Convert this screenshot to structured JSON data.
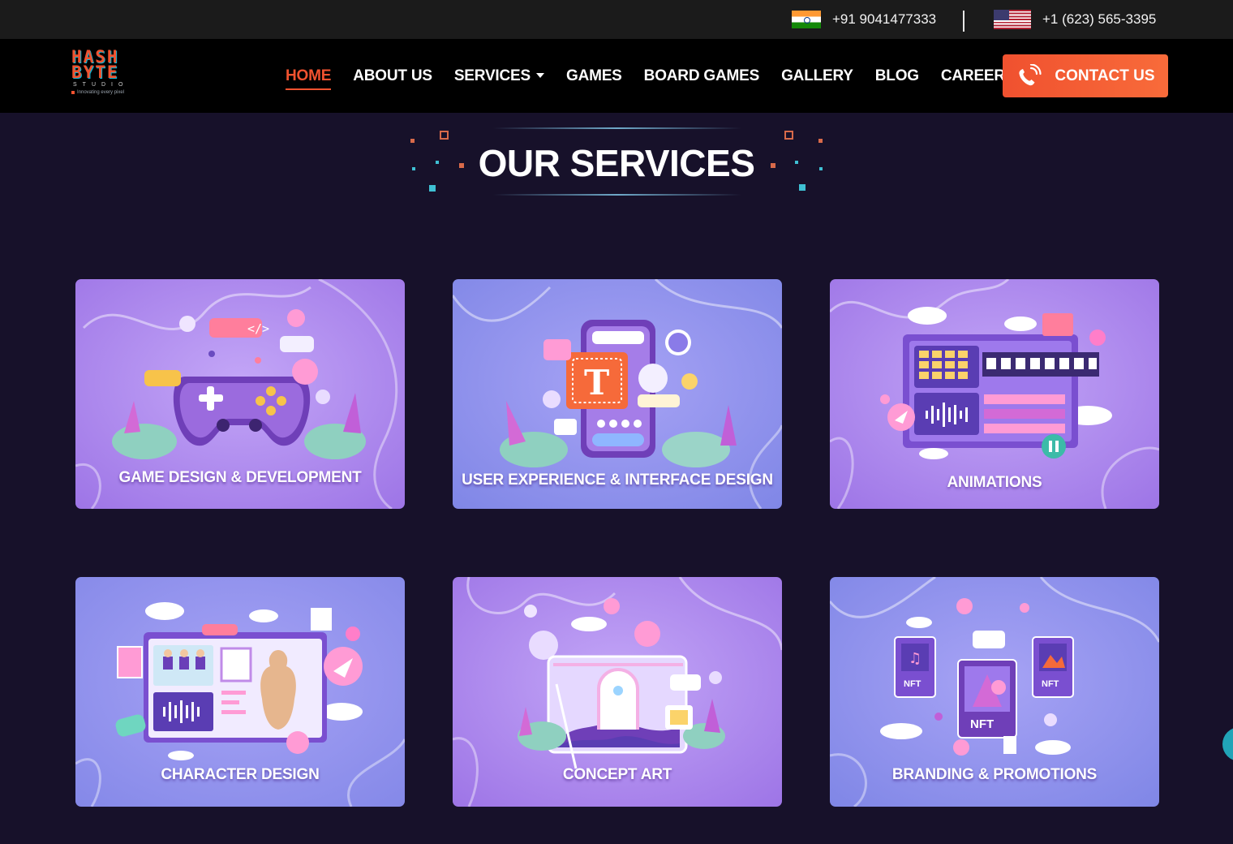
{
  "topbar": {
    "phone_india": "+91 9041477333",
    "phone_us": "+1 (623) 565-3395",
    "india_flag_icon": "india-flag-icon",
    "us_flag_icon": "us-flag-icon"
  },
  "brand": {
    "logo_line1": "HASH",
    "logo_line2": "BYTE",
    "logo_line3": "STUDIO",
    "tagline": "Innovating every pixel",
    "accent_color": "#f0522f",
    "background_color": "#17112a"
  },
  "nav": {
    "items": [
      {
        "label": "HOME",
        "active": true
      },
      {
        "label": "ABOUT US"
      },
      {
        "label": "SERVICES",
        "has_dropdown": true
      },
      {
        "label": "GAMES"
      },
      {
        "label": "BOARD GAMES"
      },
      {
        "label": "GALLERY"
      },
      {
        "label": "BLOG"
      },
      {
        "label": "CAREER"
      }
    ],
    "contact_label": "CONTACT US",
    "contact_icon": "phone-ringing-icon"
  },
  "section": {
    "heading": "OUR SERVICES"
  },
  "services": [
    {
      "title": "GAME DESIGN & DEVELOPMENT",
      "icon": "gamepad-illustration"
    },
    {
      "title": "USER EXPERIENCE & INTERFACE DESIGN",
      "icon": "mobile-ui-illustration"
    },
    {
      "title": "ANIMATIONS",
      "icon": "video-timeline-illustration"
    },
    {
      "title": "CHARACTER DESIGN",
      "icon": "character-model-illustration"
    },
    {
      "title": "CONCEPT ART",
      "icon": "art-canvas-illustration"
    },
    {
      "title": "BRANDING & PROMOTIONS",
      "icon": "nft-cards-illustration"
    }
  ]
}
